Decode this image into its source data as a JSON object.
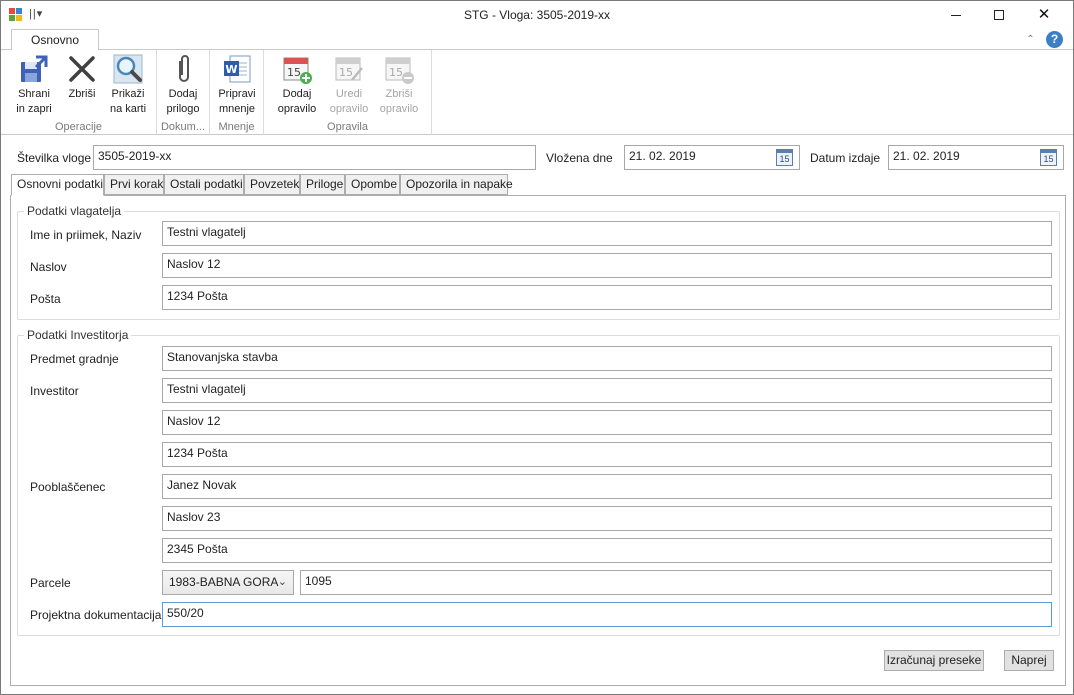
{
  "window": {
    "title": "STG - Vloga: 3505-2019-xx",
    "qat_text": "||▾"
  },
  "ribbon": {
    "tab": "Osnovno",
    "groups": [
      {
        "label": "Operacije",
        "buttons": [
          {
            "line1": "Shrani",
            "line2": "in zapri",
            "icon": "save-close-icon",
            "enabled": true
          },
          {
            "line1": "Zbriši",
            "line2": "",
            "icon": "delete-x-icon",
            "enabled": true
          },
          {
            "line1": "Prikaži",
            "line2": "na karti",
            "icon": "magnifier-map-icon",
            "enabled": true
          }
        ]
      },
      {
        "label": "Dokum...",
        "buttons": [
          {
            "line1": "Dodaj",
            "line2": "prilogo",
            "icon": "paperclip-icon",
            "enabled": true
          }
        ]
      },
      {
        "label": "Mnenje",
        "buttons": [
          {
            "line1": "Pripravi",
            "line2": "mnenje",
            "icon": "word-document-icon",
            "enabled": true
          }
        ]
      },
      {
        "label": "Opravila",
        "buttons": [
          {
            "line1": "Dodaj",
            "line2": "opravilo",
            "icon": "calendar-add-icon",
            "enabled": true
          },
          {
            "line1": "Uredi",
            "line2": "opravilo",
            "icon": "calendar-edit-icon",
            "enabled": false
          },
          {
            "line1": "Zbriši",
            "line2": "opravilo",
            "icon": "calendar-remove-icon",
            "enabled": false
          }
        ]
      }
    ],
    "calendar_day": "15"
  },
  "header": {
    "stevilka_label": "Številka vloge",
    "stevilka_value": "3505-2019-xx",
    "vlozena_label": "Vložena dne",
    "vlozena_value": "21. 02. 2019",
    "izdaja_label": "Datum izdaje",
    "izdaja_value": "21. 02. 2019",
    "calendar_day": "15"
  },
  "tabs": [
    "Osnovni podatki",
    "Prvi korak",
    "Ostali podatki",
    "Povzetek",
    "Priloge",
    "Opombe",
    "Opozorila in napake"
  ],
  "vlagatelj": {
    "legend": "Podatki vlagatelja",
    "rows": [
      {
        "label": "Ime in priimek, Naziv",
        "value": "Testni vlagatelj"
      },
      {
        "label": "Naslov",
        "value": "Naslov 12"
      },
      {
        "label": "Pošta",
        "value": "1234 Pošta"
      }
    ]
  },
  "investitor": {
    "legend": "Podatki Investitorja",
    "predmet_label": "Predmet gradnje",
    "predmet_value": "Stanovanjska stavba",
    "investitor_label": "Investitor",
    "investitor_values": [
      "Testni vlagatelj",
      "Naslov 12",
      "1234 Pošta"
    ],
    "pooblascenec_label": "Pooblaščenec",
    "pooblascenec_values": [
      "Janez Novak",
      "Naslov 23",
      "2345 Pošta"
    ],
    "parcele_label": "Parcele",
    "parcele_ko": "1983-BABNA GORA",
    "parcele_number": "1095",
    "projektna_label": "Projektna dokumentacija",
    "projektna_value": "550/20"
  },
  "footer": {
    "izracunaj": "Izračunaj preseke",
    "naprej": "Naprej"
  }
}
